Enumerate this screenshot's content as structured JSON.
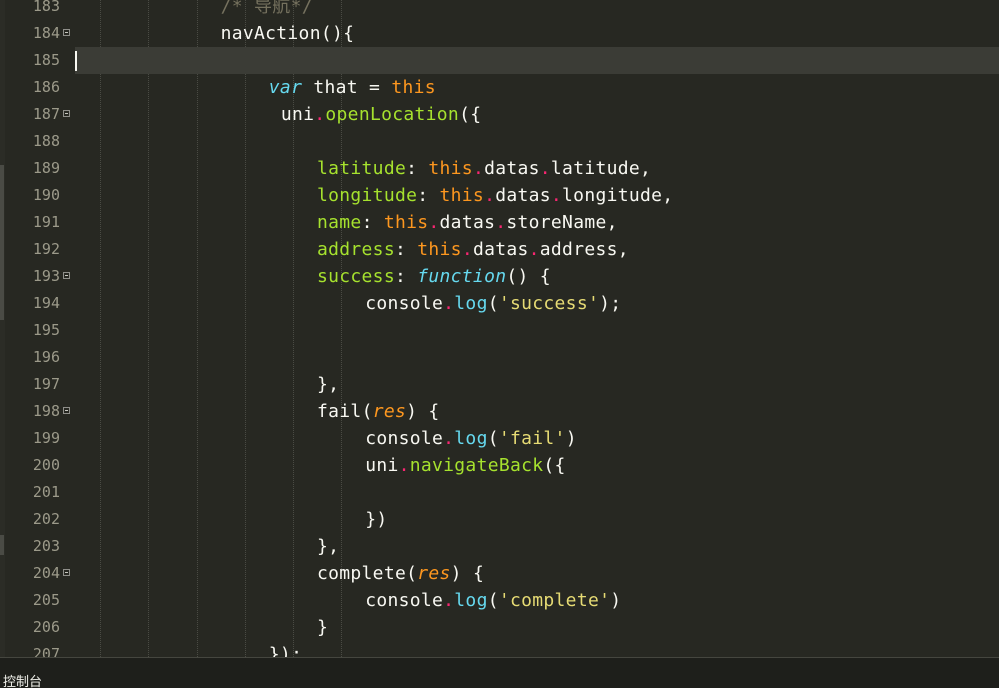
{
  "editor": {
    "current_line": 185,
    "lines": [
      {
        "n": "183",
        "indent": 6,
        "fold": false,
        "tokens": [
          {
            "t": "/* 导航*/",
            "k": "comment"
          }
        ]
      },
      {
        "n": "184",
        "indent": 6,
        "fold": true,
        "tokens": [
          {
            "t": "navAction(){",
            "k": "plain"
          }
        ]
      },
      {
        "n": "185",
        "indent": 0,
        "fold": false,
        "current": true,
        "tokens": []
      },
      {
        "n": "186",
        "indent": 8,
        "fold": false,
        "tokens": [
          {
            "t": "var",
            "k": "keyword"
          },
          {
            "t": " that = ",
            "k": "plain"
          },
          {
            "t": "this",
            "k": "builtin"
          }
        ]
      },
      {
        "n": "187",
        "indent": 8.5,
        "fold": true,
        "tokens": [
          {
            "t": "uni",
            "k": "plain"
          },
          {
            "t": ".",
            "k": "punct"
          },
          {
            "t": "openLocation",
            "k": "func"
          },
          {
            "t": "({",
            "k": "plain"
          }
        ]
      },
      {
        "n": "188",
        "indent": 0,
        "fold": false,
        "tokens": []
      },
      {
        "n": "189",
        "indent": 10,
        "fold": false,
        "tokens": [
          {
            "t": "latitude",
            "k": "func"
          },
          {
            "t": ": ",
            "k": "plain"
          },
          {
            "t": "this",
            "k": "builtin"
          },
          {
            "t": ".",
            "k": "punct"
          },
          {
            "t": "datas",
            "k": "plain"
          },
          {
            "t": ".",
            "k": "punct"
          },
          {
            "t": "latitude,",
            "k": "plain"
          }
        ]
      },
      {
        "n": "190",
        "indent": 10,
        "fold": false,
        "tokens": [
          {
            "t": "longitude",
            "k": "func"
          },
          {
            "t": ": ",
            "k": "plain"
          },
          {
            "t": "this",
            "k": "builtin"
          },
          {
            "t": ".",
            "k": "punct"
          },
          {
            "t": "datas",
            "k": "plain"
          },
          {
            "t": ".",
            "k": "punct"
          },
          {
            "t": "longitude,",
            "k": "plain"
          }
        ]
      },
      {
        "n": "191",
        "indent": 10,
        "fold": false,
        "tokens": [
          {
            "t": "name",
            "k": "func"
          },
          {
            "t": ": ",
            "k": "plain"
          },
          {
            "t": "this",
            "k": "builtin"
          },
          {
            "t": ".",
            "k": "punct"
          },
          {
            "t": "datas",
            "k": "plain"
          },
          {
            "t": ".",
            "k": "punct"
          },
          {
            "t": "storeName,",
            "k": "plain"
          }
        ]
      },
      {
        "n": "192",
        "indent": 10,
        "fold": false,
        "tokens": [
          {
            "t": "address",
            "k": "func"
          },
          {
            "t": ": ",
            "k": "plain"
          },
          {
            "t": "this",
            "k": "builtin"
          },
          {
            "t": ".",
            "k": "punct"
          },
          {
            "t": "datas",
            "k": "plain"
          },
          {
            "t": ".",
            "k": "punct"
          },
          {
            "t": "address,",
            "k": "plain"
          }
        ]
      },
      {
        "n": "193",
        "indent": 10,
        "fold": true,
        "tokens": [
          {
            "t": "success",
            "k": "func"
          },
          {
            "t": ": ",
            "k": "plain"
          },
          {
            "t": "function",
            "k": "keyword"
          },
          {
            "t": "() {",
            "k": "plain"
          }
        ]
      },
      {
        "n": "194",
        "indent": 12,
        "fold": false,
        "tokens": [
          {
            "t": "console",
            "k": "plain"
          },
          {
            "t": ".",
            "k": "punct"
          },
          {
            "t": "log",
            "k": "keyword_plain"
          },
          {
            "t": "(",
            "k": "plain"
          },
          {
            "t": "'success'",
            "k": "string"
          },
          {
            "t": ");",
            "k": "plain"
          }
        ]
      },
      {
        "n": "195",
        "indent": 0,
        "fold": false,
        "tokens": []
      },
      {
        "n": "196",
        "indent": 0,
        "fold": false,
        "tokens": []
      },
      {
        "n": "197",
        "indent": 10,
        "fold": false,
        "tokens": [
          {
            "t": "},",
            "k": "plain"
          }
        ]
      },
      {
        "n": "198",
        "indent": 10,
        "fold": true,
        "tokens": [
          {
            "t": "fail",
            "k": "plain"
          },
          {
            "t": "(",
            "k": "plain"
          },
          {
            "t": "res",
            "k": "param"
          },
          {
            "t": ") {",
            "k": "plain"
          }
        ]
      },
      {
        "n": "199",
        "indent": 12,
        "fold": false,
        "tokens": [
          {
            "t": "console",
            "k": "plain"
          },
          {
            "t": ".",
            "k": "punct"
          },
          {
            "t": "log",
            "k": "keyword_plain"
          },
          {
            "t": "(",
            "k": "plain"
          },
          {
            "t": "'fail'",
            "k": "string"
          },
          {
            "t": ")",
            "k": "plain"
          }
        ]
      },
      {
        "n": "200",
        "indent": 12,
        "fold": false,
        "tokens": [
          {
            "t": "uni",
            "k": "plain"
          },
          {
            "t": ".",
            "k": "punct"
          },
          {
            "t": "navigateBack",
            "k": "func"
          },
          {
            "t": "({",
            "k": "plain"
          }
        ]
      },
      {
        "n": "201",
        "indent": 0,
        "fold": false,
        "tokens": []
      },
      {
        "n": "202",
        "indent": 12,
        "fold": false,
        "tokens": [
          {
            "t": "})",
            "k": "plain"
          }
        ]
      },
      {
        "n": "203",
        "indent": 10,
        "fold": false,
        "tokens": [
          {
            "t": "},",
            "k": "plain"
          }
        ]
      },
      {
        "n": "204",
        "indent": 10,
        "fold": true,
        "tokens": [
          {
            "t": "complete",
            "k": "plain"
          },
          {
            "t": "(",
            "k": "plain"
          },
          {
            "t": "res",
            "k": "param"
          },
          {
            "t": ") {",
            "k": "plain"
          }
        ]
      },
      {
        "n": "205",
        "indent": 12,
        "fold": false,
        "tokens": [
          {
            "t": "console",
            "k": "plain"
          },
          {
            "t": ".",
            "k": "punct"
          },
          {
            "t": "log",
            "k": "keyword_plain"
          },
          {
            "t": "(",
            "k": "plain"
          },
          {
            "t": "'complete'",
            "k": "string"
          },
          {
            "t": ")",
            "k": "plain"
          }
        ]
      },
      {
        "n": "206",
        "indent": 10,
        "fold": false,
        "tokens": [
          {
            "t": "}",
            "k": "plain"
          }
        ]
      },
      {
        "n": "207",
        "indent": 8,
        "fold": false,
        "tokens": [
          {
            "t": "});",
            "k": "plain"
          }
        ]
      }
    ]
  },
  "bottom_panel": {
    "console_tab": "控制台"
  },
  "colors": {
    "background": "#272822",
    "current_line": "#3b3c36",
    "keyword": "#66d9ef",
    "builtin": "#fd971f",
    "function": "#a6e22e",
    "punct": "#f92672",
    "string": "#e6db74",
    "comment": "#75715e"
  }
}
